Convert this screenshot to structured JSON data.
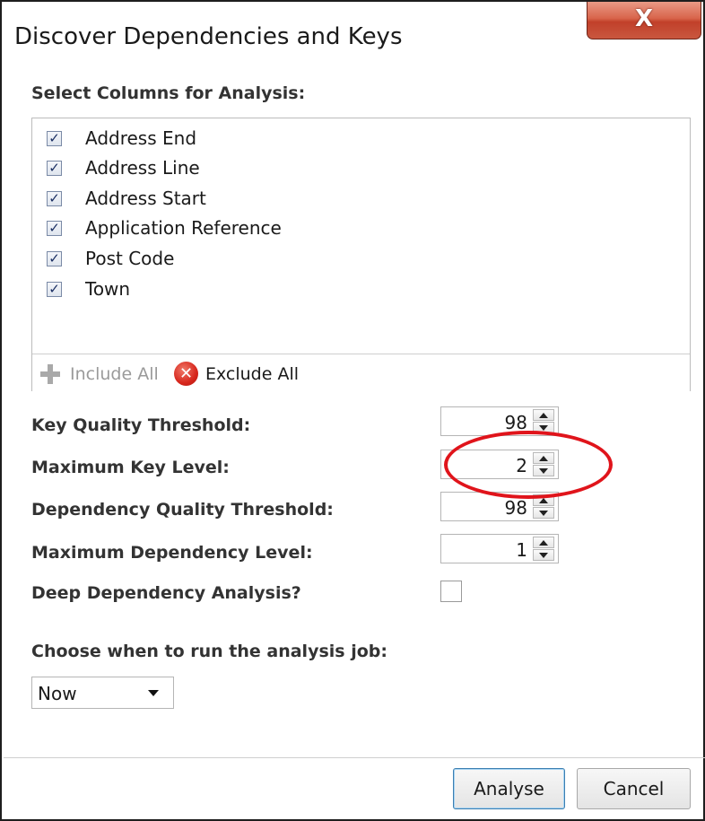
{
  "window": {
    "title": "Discover Dependencies and Keys",
    "close_glyph": "X"
  },
  "columns": {
    "heading": "Select Columns for Analysis:",
    "items": [
      {
        "label": "Address End",
        "checked": true
      },
      {
        "label": "Address Line",
        "checked": true
      },
      {
        "label": "Address Start",
        "checked": true
      },
      {
        "label": "Application Reference",
        "checked": true
      },
      {
        "label": "Post Code",
        "checked": true
      },
      {
        "label": "Town",
        "checked": true
      }
    ],
    "check_glyph": "✓",
    "include_all": "Include All",
    "exclude_all": "Exclude All"
  },
  "settings": {
    "key_quality_threshold": {
      "label": "Key Quality Threshold:",
      "value": "98"
    },
    "maximum_key_level": {
      "label": "Maximum Key Level:",
      "value": "2"
    },
    "dependency_quality_threshold": {
      "label": "Dependency Quality Threshold:",
      "value": "98"
    },
    "maximum_dependency_level": {
      "label": "Maximum Dependency Level:",
      "value": "1"
    },
    "deep_dependency_analysis": {
      "label": "Deep Dependency Analysis?",
      "checked": false
    }
  },
  "schedule": {
    "label": "Choose when to run the analysis job:",
    "selected": "Now"
  },
  "buttons": {
    "analyse": "Analyse",
    "cancel": "Cancel"
  },
  "icons": {
    "close": "close-icon",
    "include": "plus-icon",
    "exclude": "x-circle-icon"
  },
  "colors": {
    "close_button": "#d04a32",
    "highlight_ellipse": "#e0141b",
    "check_mark": "#1b2f63"
  }
}
